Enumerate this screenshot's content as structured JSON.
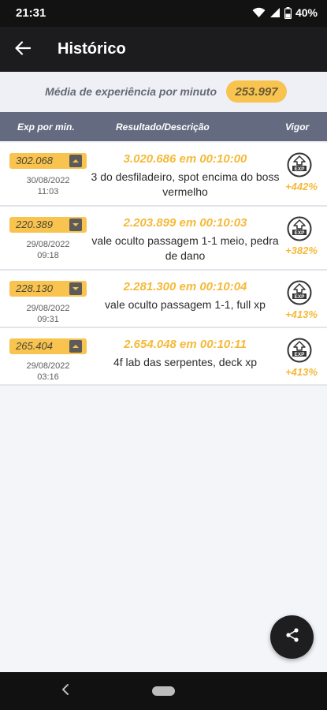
{
  "status_bar": {
    "time": "21:31",
    "battery": "40%"
  },
  "app_bar": {
    "title": "Histórico",
    "back_icon": "arrow-left-icon"
  },
  "average": {
    "label": "Média de experiência por minuto",
    "value": "253.997"
  },
  "columns": {
    "exp": "Exp por min.",
    "result": "Resultado/Descrição",
    "vigor": "Vigor"
  },
  "entries": [
    {
      "exp": "302.068",
      "toggle": "chevron-up-icon",
      "date": "30/08/2022",
      "time": "11:03",
      "result": "3.020.686 em 00:10:00",
      "desc": "3 do desfiladeiro, spot encima do boss vermelho",
      "vigor": "+442%"
    },
    {
      "exp": "220.389",
      "toggle": "chevron-down-icon",
      "date": "29/08/2022",
      "time": "09:18",
      "result": "2.203.899 em 00:10:03",
      "desc": "vale oculto passagem 1-1 meio, pedra de dano",
      "vigor": "+382%"
    },
    {
      "exp": "228.130",
      "toggle": "chevron-down-icon",
      "date": "29/08/2022",
      "time": "09:31",
      "result": "2.281.300 em 00:10:04",
      "desc": "vale oculto passagem 1-1, full xp",
      "vigor": "+413%"
    },
    {
      "exp": "265.404",
      "toggle": "chevron-up-icon",
      "date": "29/08/2022",
      "time": "03:16",
      "result": "2.654.048 em 00:10:11",
      "desc": "4f lab das serpentes, deck xp",
      "vigor": "+413%"
    }
  ],
  "icons": {
    "exp_badge": "exp-boost-icon",
    "share": "share-icon"
  },
  "colors": {
    "accent": "#f8c44f",
    "header": "#646b80",
    "appbar": "#1c1c1e"
  }
}
